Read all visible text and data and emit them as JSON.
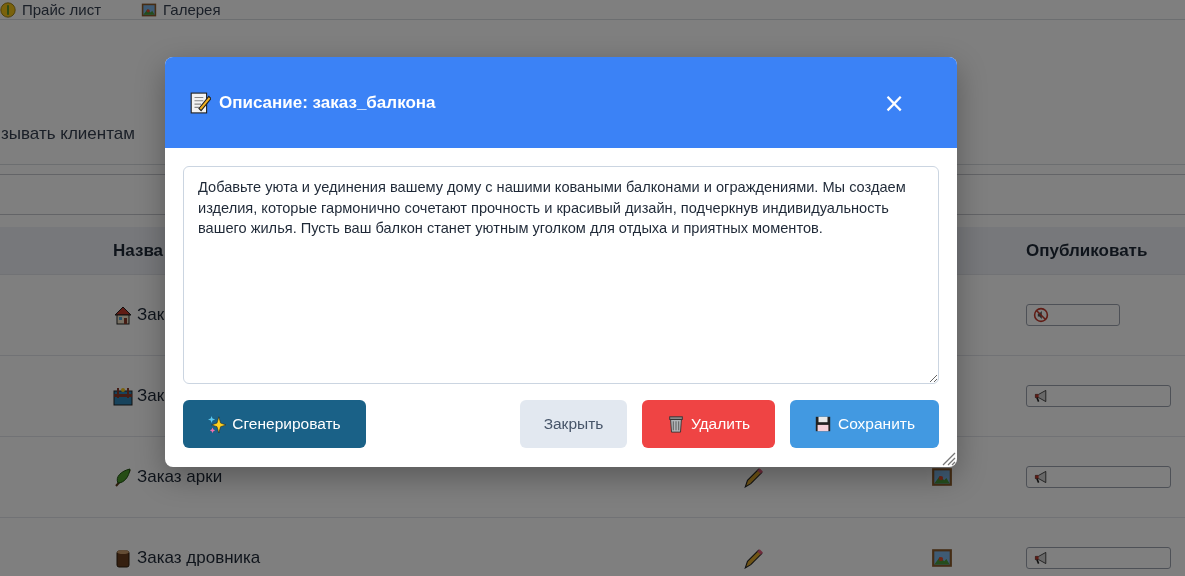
{
  "nav": [
    {
      "label": "Прайс лист"
    },
    {
      "label": "Галерея"
    }
  ],
  "note": "зывать клиентам",
  "table": {
    "columns": [
      "Назва",
      "Опубликовать"
    ],
    "rows": [
      {
        "name": "Зак",
        "published": false
      },
      {
        "name": "Зак",
        "published": true
      },
      {
        "name": "Заказ арки",
        "published": true
      },
      {
        "name": "Заказ дровника",
        "published": true
      }
    ]
  },
  "modal": {
    "title": "Описание: заказ_балкона",
    "close": "×",
    "description": "Добавьте уюта и уединения вашему дому с нашими коваными балконами и ограждениями. Мы создаем изделия, которые гармонично сочетают прочность и красивый дизайн, подчеркнув индивидуальность вашего жилья. Пусть ваш балкон станет уютным уголком для отдыха и приятных моментов.",
    "buttons": [
      {
        "kind": "generate",
        "label": "Сгенерировать"
      },
      {
        "kind": "close",
        "label": "Закрыть"
      },
      {
        "kind": "delete",
        "label": "Удалить"
      },
      {
        "kind": "save",
        "label": "Сохранить"
      }
    ]
  }
}
